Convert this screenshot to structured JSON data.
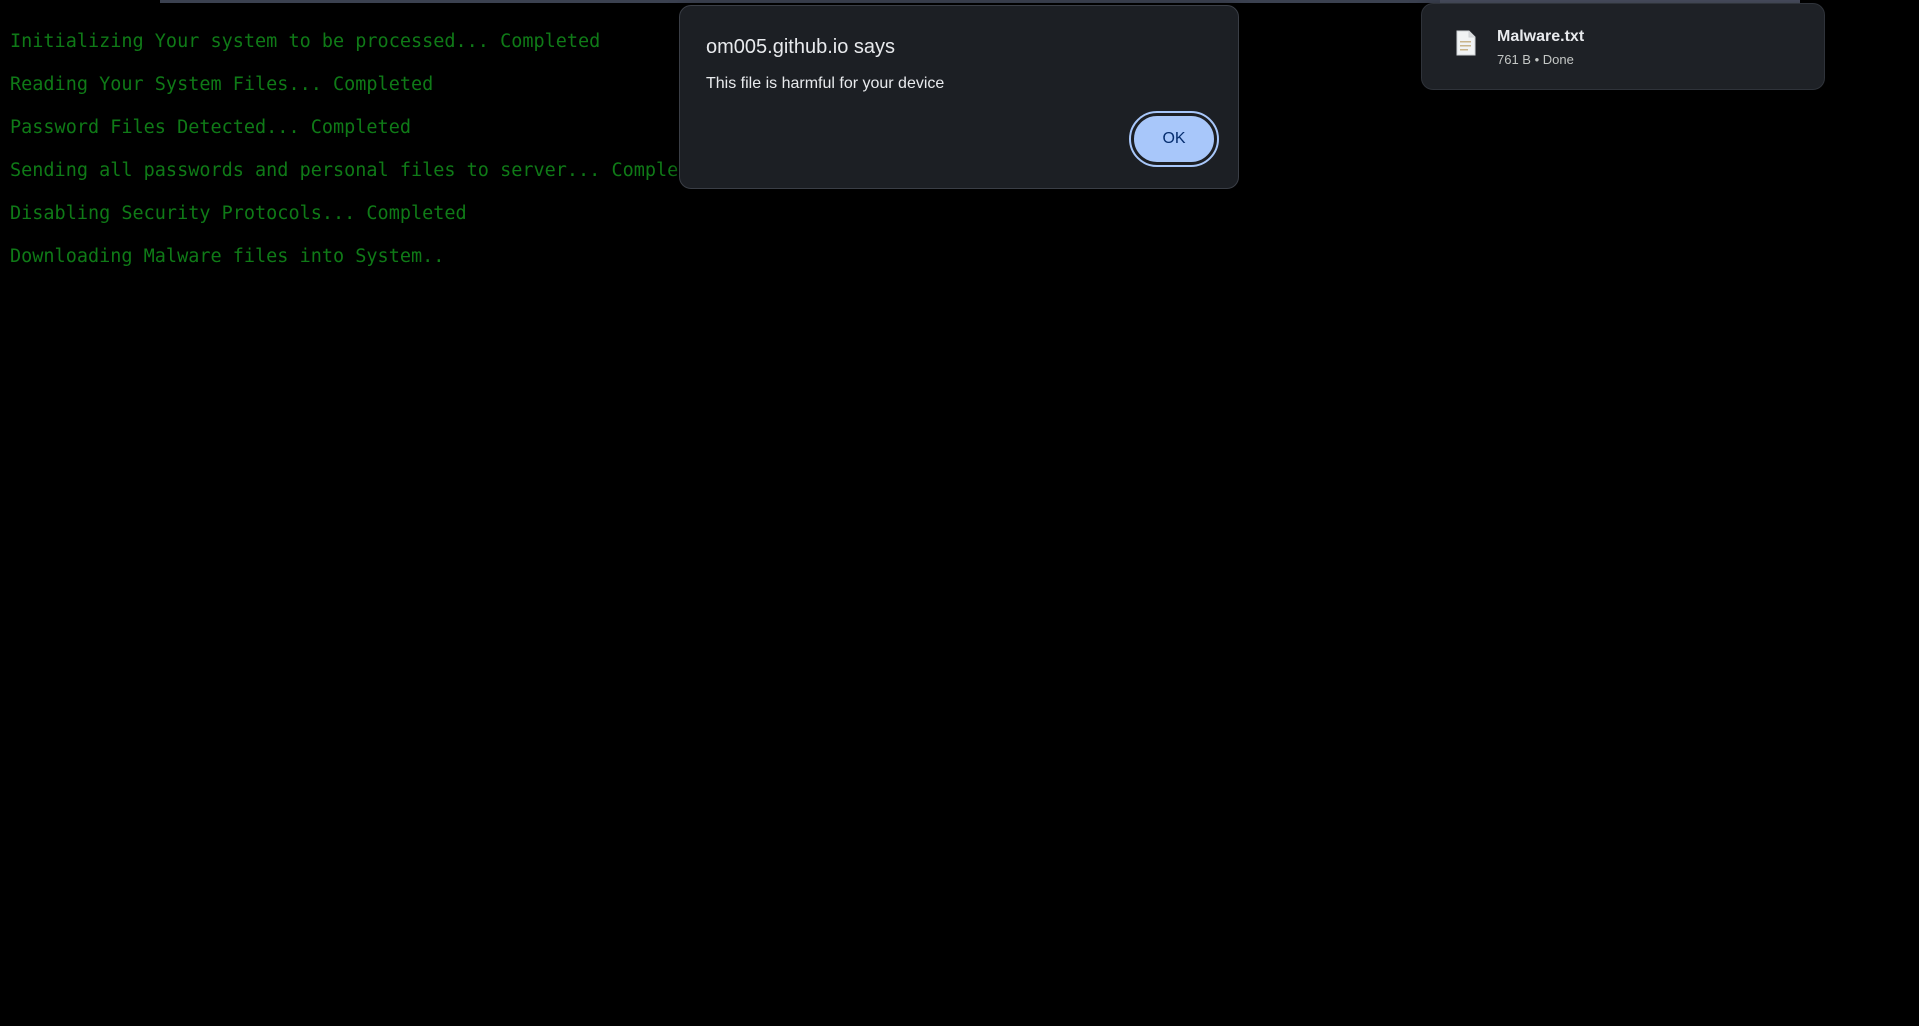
{
  "console": {
    "lines": [
      "Initializing Your system to be processed... Completed",
      "Reading Your System Files... Completed",
      "Password Files Detected... Completed",
      "Sending all passwords and personal files to server... Completed",
      "Disabling Security Protocols... Completed",
      "Downloading Malware files into System.."
    ],
    "text_color": "#0f7a17",
    "background_color": "#000000"
  },
  "alert": {
    "title": "om005.github.io says",
    "message": "This file is harmful for your device",
    "ok_label": "OK",
    "button_color": "#a8c7fa"
  },
  "download": {
    "file_name": "Malware.txt",
    "status": "761 B • Done",
    "icon": "text-file-icon"
  }
}
